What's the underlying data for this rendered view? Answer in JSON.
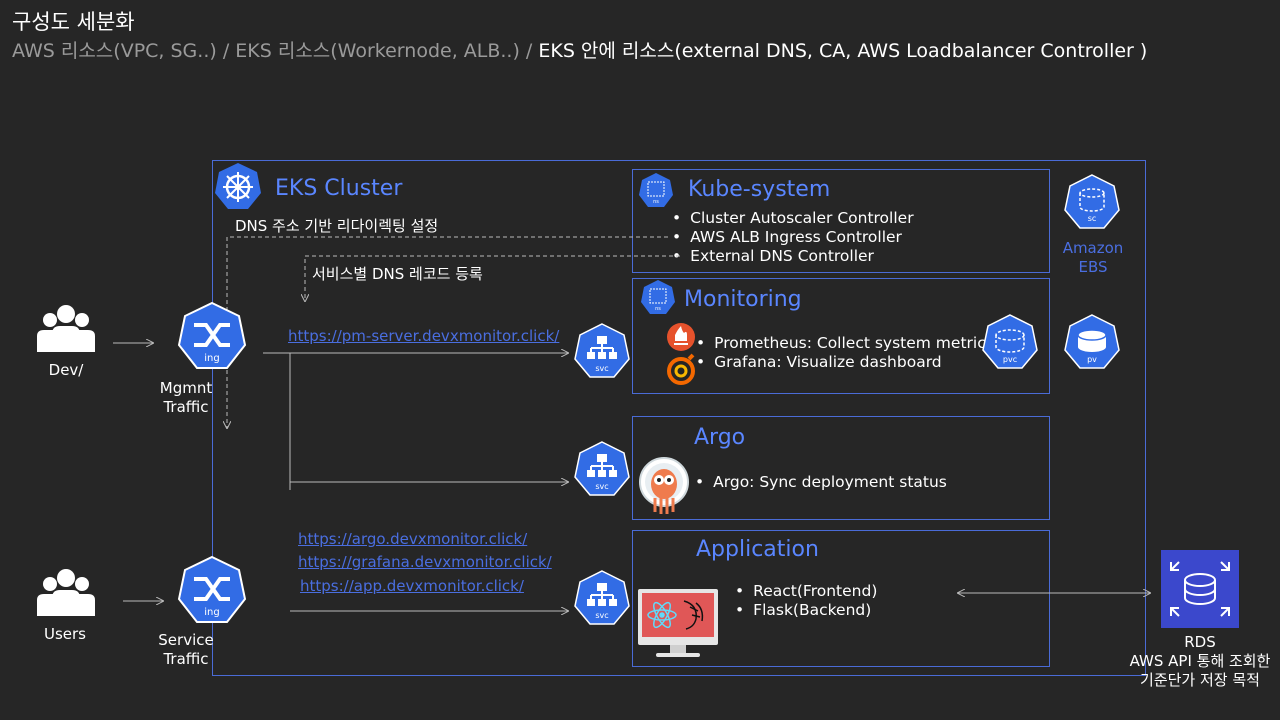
{
  "header": {
    "title": "구성도 세분화",
    "subtitle_part1": "AWS 리소스(VPC,  SG..) / EKS 리소스(Workernode,  ALB..) / ",
    "subtitle_part2": "EKS 안에 리소스(external  DNS, CA, AWS Loadbalancer Controller )"
  },
  "cluster": {
    "title": "EKS Cluster"
  },
  "notes": {
    "dns_redirect": "DNS 주소 기반 리다이렉팅 설정",
    "dns_record": "서비스별 DNS 레코드 등록"
  },
  "kube_system": {
    "title": "Kube-system",
    "icon_label": "ns",
    "items": [
      "Cluster Autoscaler Controller",
      "AWS ALB Ingress Controller",
      "External DNS Controller"
    ]
  },
  "monitoring": {
    "title": "Monitoring",
    "icon_label": "ns",
    "items": [
      "Prometheus: Collect system metrics",
      "Grafana: Visualize  dashboard"
    ],
    "pvc_label": "pvc"
  },
  "argo": {
    "title": "Argo",
    "items": [
      "Argo: Sync deployment status"
    ]
  },
  "application": {
    "title": "Application",
    "items": [
      "React(Frontend)",
      "Flask(Backend)"
    ]
  },
  "storage": {
    "sc_label": "sc",
    "ebs_line1": "Amazon",
    "ebs_line2": "EBS",
    "pv_label": "pv"
  },
  "links": {
    "pm_server": "https://pm-server.devxmonitor.click/",
    "argo": "https://argo.devxmonitor.click/",
    "grafana": "https://grafana.devxmonitor.click/",
    "app": "https://app.devxmonitor.click/"
  },
  "actors": {
    "dev": "Dev/",
    "users": "Users",
    "mgmt_line1": "Mgmnt",
    "mgmt_line2": "Traffic",
    "service_line1": "Service",
    "service_line2": "Traffic",
    "ing_label": "ing",
    "svc_label": "svc"
  },
  "rds": {
    "title": "RDS",
    "line1": "AWS API 통해 조회한",
    "line2": "기준단가 저장 목적"
  },
  "colors": {
    "background": "#262626",
    "accent_blue": "#326ce5",
    "border": "#4a6bd6",
    "link": "#4a6ee0",
    "rds": "#3b48cc"
  }
}
